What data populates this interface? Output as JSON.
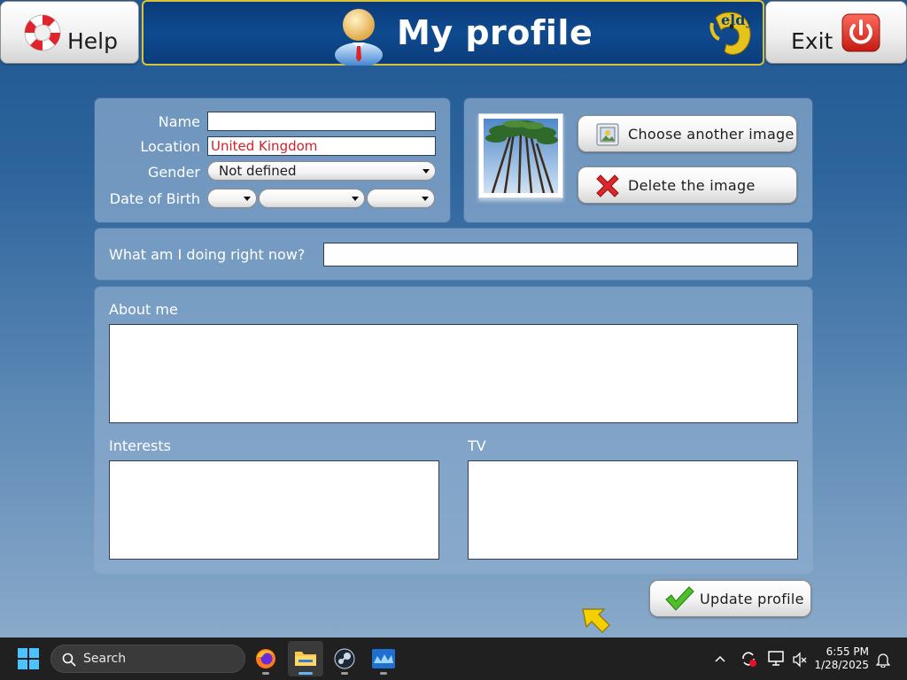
{
  "header": {
    "help_label": "Help",
    "title": "My profile",
    "exit_label": "Exit",
    "logo_text": "eldy"
  },
  "basic_info": {
    "name_label": "Name",
    "name_value": "",
    "location_label": "Location",
    "location_value": "United Kingdom",
    "gender_label": "Gender",
    "gender_value": "Not defined",
    "dob_label": "Date of Birth",
    "dob_day": "",
    "dob_month": "",
    "dob_year": ""
  },
  "image_panel": {
    "choose_label": "Choose another image",
    "delete_label": "Delete the image"
  },
  "status": {
    "label": "What am I doing right now?",
    "value": ""
  },
  "about": {
    "about_label": "About me",
    "interests_label": "Interests",
    "tv_label": "TV"
  },
  "actions": {
    "update_label": "Update profile"
  },
  "taskbar": {
    "search_placeholder": "Search",
    "time": "6:55 PM",
    "date": "1/28/2025"
  },
  "colors": {
    "accent_gold": "#d9c33b",
    "title_bg": "#0f4a90",
    "location_text": "#d4202a"
  }
}
